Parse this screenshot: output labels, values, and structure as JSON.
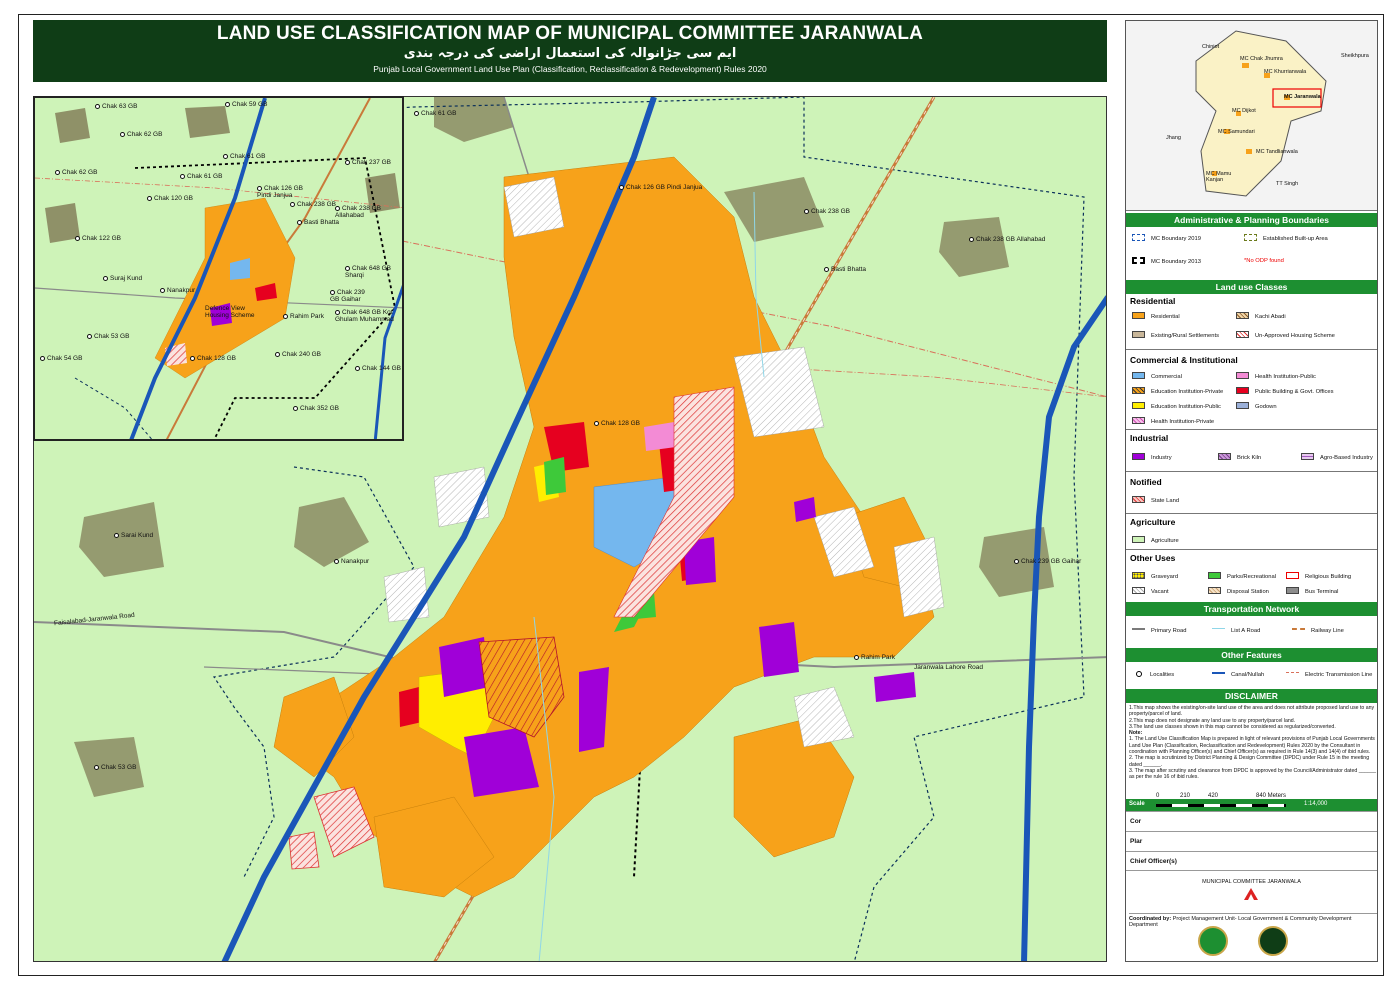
{
  "title": {
    "main": "LAND USE CLASSIFICATION MAP OF MUNICIPAL COMMITTEE JARANWALA",
    "urdu": "ایم سی جڑانوالہ کی استعمال اراضی کی درجہ بندی",
    "subtitle": "Punjab Local Government Land Use Plan (Classification, Reclassification & Redevelopment) Rules 2020"
  },
  "main_map_labels": [
    "Chak 61 GB",
    "Chak 126 GB Pindi Janjua",
    "Chak 238 GB",
    "Basti Bhatta",
    "Chak 238 GB Allahabad",
    "Chak 128 GB",
    "Rahim Park",
    "Faisalabad-Jaranwala Road",
    "Jaranwala Lahore Road",
    "Sarai Kund",
    "Chak 239 GB Gaihar",
    "Chak 53 GB",
    "Nanakpur"
  ],
  "inset_labels": [
    "Chak 63 GB",
    "Chak 59 GB",
    "Chak 62 GB",
    "Chak 61 GB",
    "Chak 237 GB",
    "Chak 62 GB",
    "Chak 61 GB",
    "Chak 126 GB Pindi Janjua",
    "Chak 238 GB",
    "Chak 120 GB",
    "Basti Bhatta",
    "Chak 238 GB Allahabad",
    "Chak 122 GB",
    "Chak 648 GB Sharqi",
    "Suraj Kund",
    "Nanakpur",
    "Chak 239 GB Gaihar",
    "Chak 648 GB Kot Ghulam Muhammad",
    "Defence View Housing Scheme",
    "Rahim Park",
    "Chak 53 GB",
    "Chak 240 GB",
    "Chak 54 GB",
    "Chak 128 GB",
    "Chak 144 GB",
    "Chak 352 GB"
  ],
  "key_map": {
    "places": [
      "Chiniot",
      "MC Chak Jhumra",
      "Sheikhpura",
      "MC Khurrianwala",
      "MC Jaranwala",
      "MC Dijkot",
      "Jhang",
      "MC Samundari",
      "MC Tandlianwala",
      "MC Mamu Kanjan",
      "TT Singh"
    ]
  },
  "legend": {
    "admin_head": "Administrative & Planning Boundaries",
    "admin": [
      {
        "label": "MC Boundary 2019",
        "style": "dash-blue"
      },
      {
        "label": "Established Built-up Area",
        "style": "dash-olive"
      },
      {
        "label": "MC Boundary 2013",
        "style": "dash-black"
      },
      {
        "label": "*No ODP found",
        "style": "text-red"
      }
    ],
    "landuse_head": "Land use Classes",
    "groups": [
      {
        "title": "Residential",
        "items": [
          {
            "label": "Residential",
            "color": "#f7a21a",
            "pattern": ""
          },
          {
            "label": "Kachi Abadi",
            "color": "#f0d6a8",
            "pattern": "hatch-brown"
          },
          {
            "label": "Existing/Rural Settlements",
            "color": "#c9b79a",
            "pattern": ""
          },
          {
            "label": "Un-Approved Housing Scheme",
            "color": "#ffffff",
            "pattern": "hatch-red"
          }
        ]
      },
      {
        "title": "Commercial & Institutional",
        "items": [
          {
            "label": "Commercial",
            "color": "#74b7ee",
            "pattern": ""
          },
          {
            "label": "Health Institution-Public",
            "color": "#f38bd5",
            "pattern": ""
          },
          {
            "label": "Education Institution-Private",
            "color": "#f7a21a",
            "pattern": "hatch-dark"
          },
          {
            "label": "Public Building & Govt. Offices",
            "color": "#e6001f",
            "pattern": ""
          },
          {
            "label": "Education Institution-Public",
            "color": "#ffee00",
            "pattern": ""
          },
          {
            "label": "Godown",
            "color": "#9bb0d9",
            "pattern": ""
          },
          {
            "label": "Health Institution-Private",
            "color": "#f7c4ec",
            "pattern": "hatch-pink"
          }
        ]
      },
      {
        "title": "Industrial",
        "items": [
          {
            "label": "Industry",
            "color": "#a000d8",
            "pattern": ""
          },
          {
            "label": "Brick Kiln",
            "color": "#c99ad7",
            "pattern": "hatch-purple"
          },
          {
            "label": "Agro-Based Industry",
            "color": "#e8c9f0",
            "pattern": "grid-purple"
          }
        ]
      },
      {
        "title": "Notified",
        "items": [
          {
            "label": "State Land",
            "color": "#f6c8c2",
            "pattern": "cross-red"
          }
        ]
      },
      {
        "title": "Agriculture",
        "items": [
          {
            "label": "Agriculture",
            "color": "#cef3b8",
            "pattern": ""
          }
        ]
      },
      {
        "title": "Other Uses",
        "items": [
          {
            "label": "Graveyard",
            "color": "#ffee00",
            "pattern": "dots"
          },
          {
            "label": "Parks/Recreational",
            "color": "#3ec93a",
            "pattern": ""
          },
          {
            "label": "Religious Building",
            "color": "#ffffff",
            "pattern": "red-outline"
          },
          {
            "label": "Vacant",
            "color": "#ffffff",
            "pattern": "hatch-grey"
          },
          {
            "label": "Disposal Station",
            "color": "#f6e3c8",
            "pattern": "hatch-tan"
          },
          {
            "label": "Bus Terminal",
            "color": "#8d8d8d",
            "pattern": ""
          }
        ]
      }
    ],
    "transport_head": "Transportation Network",
    "transport": [
      {
        "label": "Primary Road",
        "color": "#7a7a7a"
      },
      {
        "label": "List A Road",
        "color": "#8fd6e8"
      },
      {
        "label": "Railway Line",
        "color": "#c97a3a"
      }
    ],
    "other_head": "Other Features",
    "other": [
      {
        "label": "Localities"
      },
      {
        "label": "Canal/Nullah",
        "color": "#1a56b8"
      },
      {
        "label": "Electric Transmission Line",
        "color": "#d9705a"
      }
    ]
  },
  "disclaimer": {
    "head": "DISCLAIMER",
    "lines": [
      "1.This map shows the existing/on-site land use of the area and does not attribute proposed land use to any property/parcel of land.",
      "2.This map does not designate any land use to any property/parcel land.",
      "3.The land use classes shown in this map cannot be considered as regularized/converted.",
      "Note:",
      "1. The Land Use Classification Map is prepared in light of relevant provisions of Punjab Local Governments Land Use Plan (Classification, Reclassification and Redevelopment) Rules 2020 by the Consultant in coordination with Planning Officer(s) and Chief Officer(s) as required in Rule 14(3) and 14(4) of ibid rules.",
      "2. The map is scrutinized by District Planning & Design Committee (DPDC) under Rule 15 in the meeting dated ______.",
      "3. The map after scrutiny and clearance from DPDC is approved by the Council/Administrator dated ______ as per the rule 16 of ibid rules."
    ]
  },
  "scale": {
    "label": "Scale",
    "ticks": [
      "0",
      "210",
      "420",
      "840 Meters"
    ],
    "ratio": "1:14,000"
  },
  "signatures": [
    "Cor",
    "Plar",
    "Chief Officer(s)"
  ],
  "footer": {
    "org": "MUNICIPAL COMMITTEE JARANWALA",
    "coordinated_label": "Coordinated by:",
    "coordinated_text": "Project Management Unit- Local Government & Community Development Department"
  }
}
